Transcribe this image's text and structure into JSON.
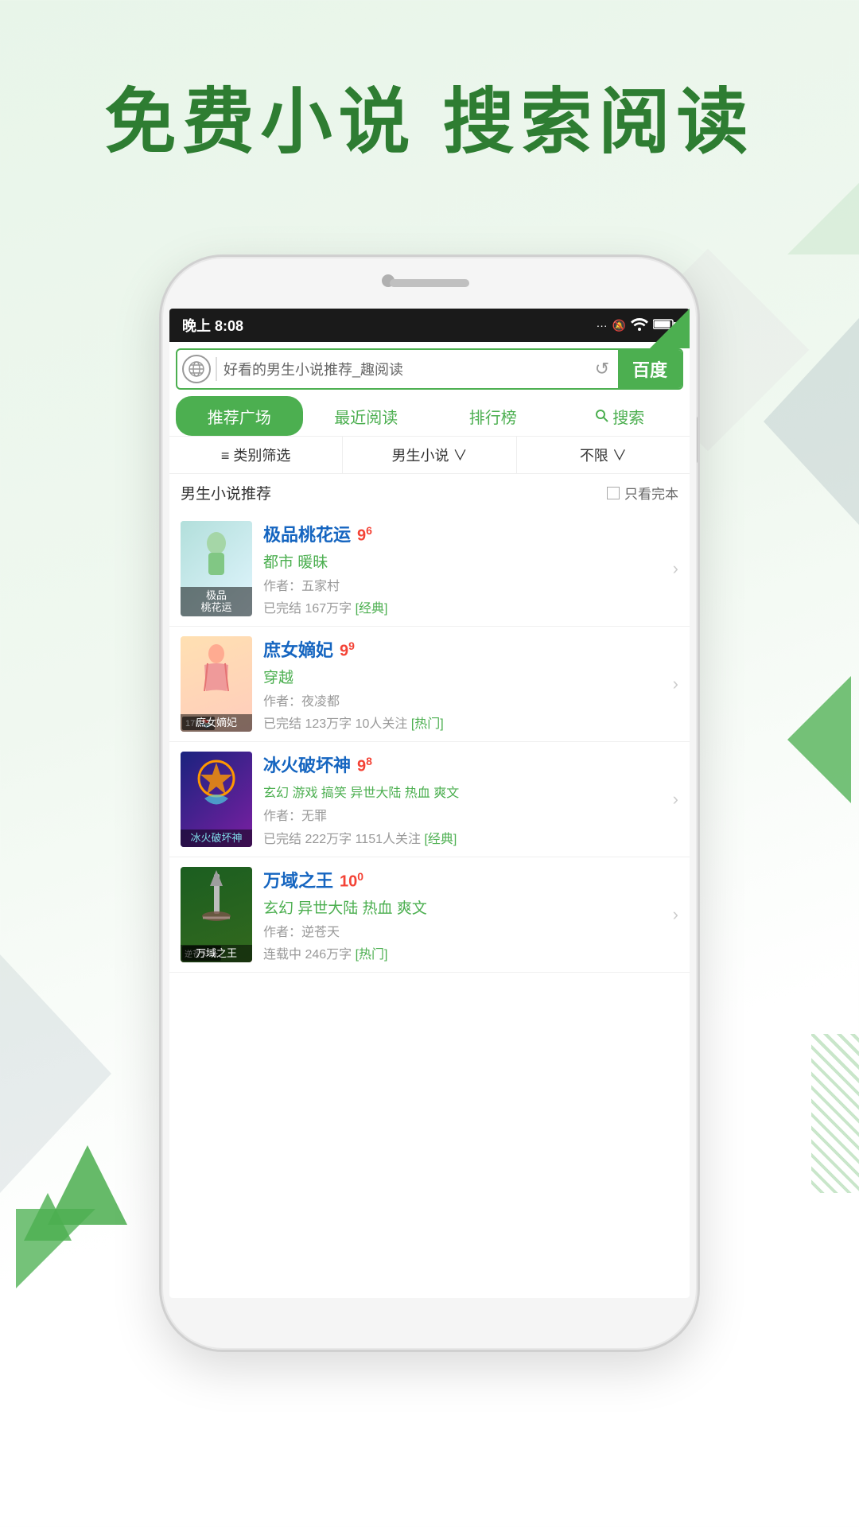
{
  "page": {
    "title": "免费小说  搜索阅读",
    "background_color": "#e8f5e9"
  },
  "status_bar": {
    "time": "晚上 8:08",
    "signal": "···",
    "mute_icon": "🔕",
    "wifi_icon": "WiFi",
    "battery": "⚡"
  },
  "search_bar": {
    "globe_icon": "🌐",
    "placeholder": "好看的男生小说推荐_趣阅读",
    "refresh_icon": "↺",
    "baidu_label": "百度"
  },
  "nav_tabs": [
    {
      "label": "推荐广场",
      "active": true
    },
    {
      "label": "最近阅读",
      "active": false
    },
    {
      "label": "排行榜",
      "active": false
    },
    {
      "label": "搜索",
      "active": false,
      "has_icon": true
    }
  ],
  "filter_bar": [
    {
      "label": "≡ 类别筛选"
    },
    {
      "label": "男生小说 ∨"
    },
    {
      "label": "不限 ∨"
    }
  ],
  "section": {
    "title": "男生小说推荐",
    "only_complete_label": "只看完本"
  },
  "books": [
    {
      "title": "极品桃花运",
      "rating": "9",
      "rating_decimal": "6",
      "genre": "都市 暖昧",
      "author": "作者：五家村",
      "stats": "已完结 167万字",
      "tag": "[经典]",
      "cover_text": "极品\n桃花运",
      "cover_style": "1"
    },
    {
      "title": "庶女嫡妃",
      "rating": "9",
      "rating_decimal": "9",
      "genre": "穿越",
      "author": "作者：夜凌都",
      "stats": "已完结 123万字 10人关注",
      "tag": "[热门]",
      "cover_text": "庶女嫡妃",
      "cover_style": "2"
    },
    {
      "title": "冰火破坏神",
      "rating": "9",
      "rating_decimal": "8",
      "genre": "玄幻 游戏 搞笑 异世大陆 热血 爽文",
      "author": "作者：无罪",
      "stats": "已完结 222万字 1151人关注",
      "tag": "[经典]",
      "cover_text": "冰火破\n坏神",
      "cover_style": "3"
    },
    {
      "title": "万域之王",
      "rating": "10",
      "rating_decimal": "0",
      "genre": "玄幻 异世大陆 热血 爽文",
      "author": "作者：逆苍天",
      "stats": "连载中 246万字",
      "tag": "[热门]",
      "cover_text": "万域之王",
      "cover_style": "4"
    }
  ]
}
